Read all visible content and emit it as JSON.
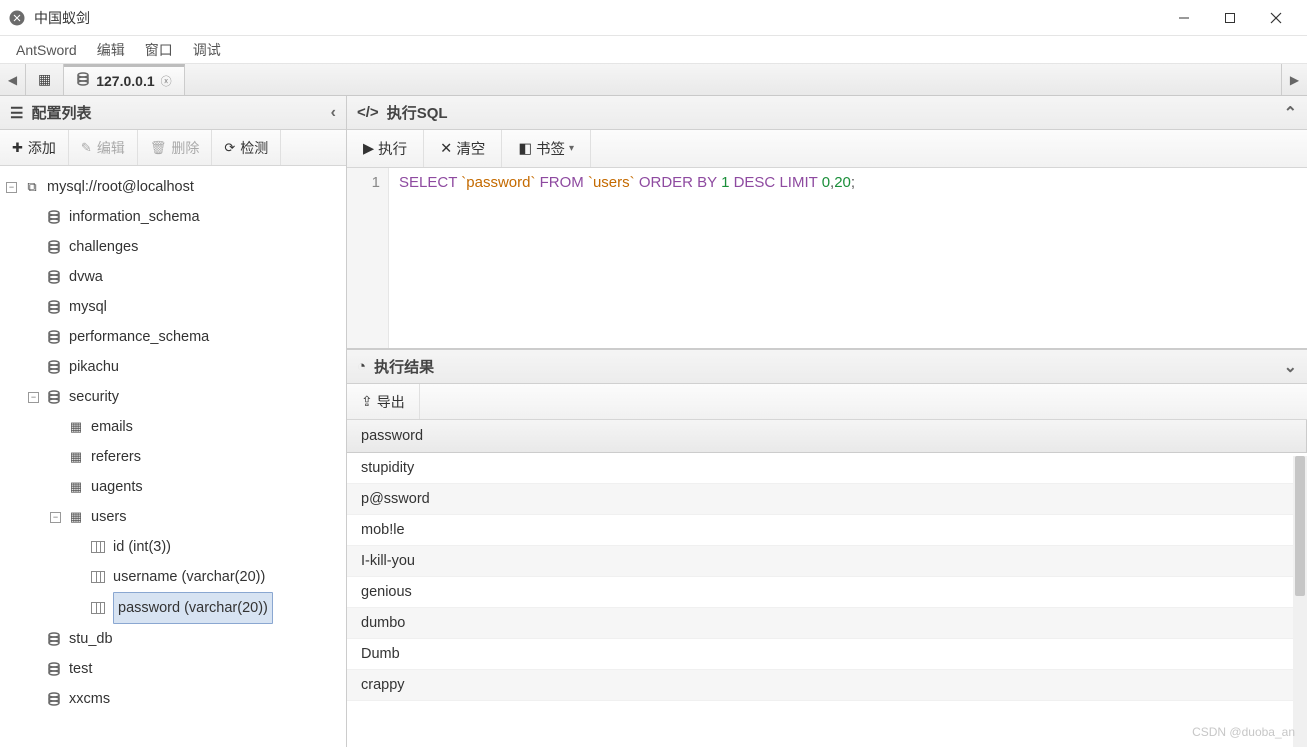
{
  "window": {
    "title": "中国蚁剑"
  },
  "menubar": {
    "items": [
      "AntSword",
      "编辑",
      "窗口",
      "调试"
    ]
  },
  "tabs": {
    "active": {
      "label": "127.0.0.1"
    }
  },
  "sidebar": {
    "title": "配置列表",
    "toolbar": {
      "add": "添加",
      "edit": "编辑",
      "delete": "删除",
      "check": "检测"
    },
    "root": "mysql://root@localhost",
    "databases": [
      "information_schema",
      "challenges",
      "dvwa",
      "mysql",
      "performance_schema",
      "pikachu",
      "security",
      "stu_db",
      "test",
      "xxcms"
    ],
    "security_tables": [
      "emails",
      "referers",
      "uagents",
      "users"
    ],
    "users_columns": [
      "id (int(3))",
      "username (varchar(20))",
      "password (varchar(20))"
    ],
    "selected_column": "password (varchar(20))"
  },
  "sql": {
    "title": "执行SQL",
    "toolbar": {
      "run": "执行",
      "clear": "清空",
      "bookmark": "书签"
    },
    "line_no": "1",
    "query": {
      "kw_select": "SELECT",
      "col": "`password`",
      "kw_from": "FROM",
      "tbl": "`users`",
      "kw_order": "ORDER BY",
      "one": "1",
      "kw_desc": "DESC",
      "kw_limit": "LIMIT",
      "zero": "0",
      "comma": ",",
      "twenty": "20",
      "semi": ";"
    }
  },
  "result": {
    "title": "执行结果",
    "toolbar": {
      "export": "导出"
    },
    "column": "password",
    "rows": [
      "stupidity",
      "p@ssword",
      "mob!le",
      "I-kill-you",
      "genious",
      "dumbo",
      "Dumb",
      "crappy"
    ]
  },
  "watermark": "CSDN @duoba_an"
}
